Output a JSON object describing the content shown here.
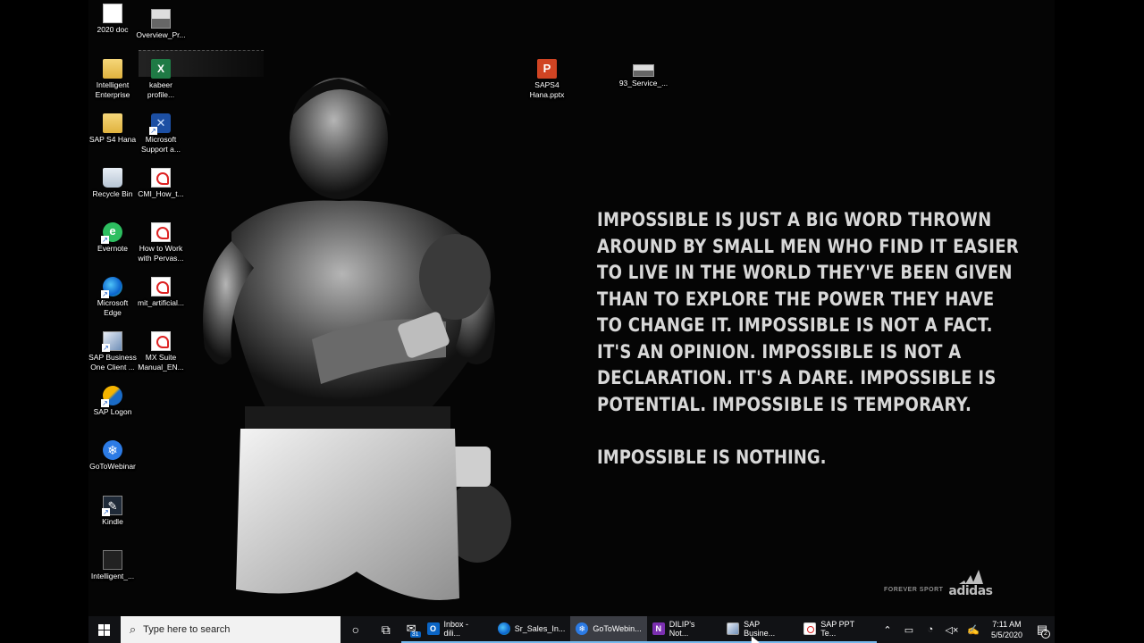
{
  "desktop": {
    "icons": [
      {
        "label": "2020 doc",
        "icon": "word-document-icon"
      },
      {
        "label": "Overview_Pr...",
        "icon": "image-file-icon"
      },
      {
        "label": "Intelligent\nEnterprise",
        "icon": "folder-icon"
      },
      {
        "label": "kabeer\nprofile...",
        "icon": "excel-file-icon"
      },
      {
        "label": "SAPS4\nHana.pptx",
        "icon": "powerpoint-file-icon"
      },
      {
        "label": "93_Service_...",
        "icon": "image-file-icon"
      },
      {
        "label": "SAP S4 Hana",
        "icon": "folder-icon"
      },
      {
        "label": "Microsoft\nSupport a...",
        "icon": "support-tool-icon"
      },
      {
        "label": "Recycle Bin",
        "icon": "recycle-bin-icon"
      },
      {
        "label": "CMI_How_t...",
        "icon": "pdf-file-icon"
      },
      {
        "label": "Evernote",
        "icon": "evernote-icon"
      },
      {
        "label": "How to Work\nwith Pervas...",
        "icon": "pdf-file-icon"
      },
      {
        "label": "Microsoft\nEdge",
        "icon": "edge-icon"
      },
      {
        "label": "mit_artificial...",
        "icon": "pdf-file-icon"
      },
      {
        "label": "SAP Business\nOne Client ...",
        "icon": "sap-business-one-icon"
      },
      {
        "label": "MX Suite\nManual_EN...",
        "icon": "pdf-file-icon"
      },
      {
        "label": "SAP Logon",
        "icon": "sap-logon-icon"
      },
      {
        "label": "GoToWebinar",
        "icon": "gotowebinar-icon"
      },
      {
        "label": "Kindle",
        "icon": "kindle-icon"
      },
      {
        "label": "Intelligent_...",
        "icon": "image-file-icon"
      }
    ]
  },
  "wallpaper": {
    "quote": "IMPOSSIBLE IS JUST A BIG WORD THROWN\nAROUND BY SMALL MEN WHO FIND IT EASIER\nTO LIVE IN THE WORLD THEY'VE BEEN GIVEN\nTHAN TO EXPLORE THE POWER THEY HAVE\nTO CHANGE IT. IMPOSSIBLE IS NOT A FACT.\nIT'S AN OPINION. IMPOSSIBLE IS NOT A\nDECLARATION. IT'S A DARE. IMPOSSIBLE IS\nPOTENTIAL. IMPOSSIBLE IS TEMPORARY.",
    "tagline": "IMPOSSIBLE IS NOTHING.",
    "brand_small": "FOREVER SPORT",
    "brand": "adidas"
  },
  "taskbar": {
    "search_placeholder": "Type here to search",
    "apps": [
      {
        "label": "",
        "icon": "mail-icon",
        "badge": "31"
      },
      {
        "label": "Inbox - dili...",
        "icon": "outlook-icon"
      },
      {
        "label": "Sr_Sales_In...",
        "icon": "edge-icon"
      },
      {
        "label": "GoToWebin...",
        "icon": "gotowebinar-icon",
        "active": true
      },
      {
        "label": "DILIP's Not...",
        "icon": "onenote-icon"
      },
      {
        "label": "SAP Busine...",
        "icon": "sap-business-one-icon"
      },
      {
        "label": "SAP PPT Te...",
        "icon": "pdf-file-icon"
      }
    ],
    "clock": {
      "time": "7:11 AM",
      "date": "5/5/2020"
    },
    "notifications": "2"
  }
}
